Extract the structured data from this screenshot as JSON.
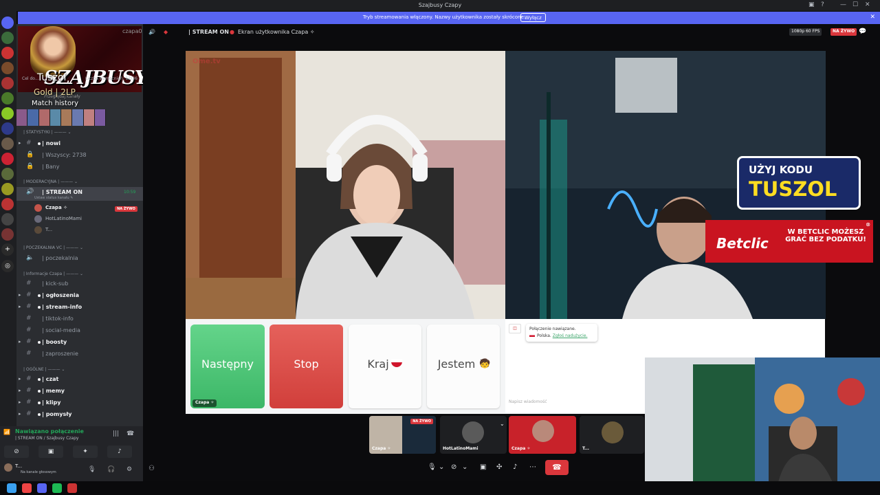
{
  "window": {
    "title": "Szajbusy Czapy"
  },
  "banner": {
    "text": "Tryb streamowania włączony. Nazwy użytkownika zostały skrócone.",
    "button": "Wyłącz"
  },
  "server": {
    "logo_text": "SZAJBUSY",
    "sub_label": "czapa0",
    "boost_left": "Cel do...",
    "boost_right": "Liczba wzmocnień: 12/36 ›",
    "browse": "Przeglądaj kanały"
  },
  "overlay": {
    "summoner": "Tuszol",
    "rank": "Gold | 2LP",
    "match_history": "Match history"
  },
  "categories": {
    "stats": "| STATYSTYKI | ——— ⌄",
    "moderation": "| MODERACYJNA | ——— ⌄",
    "waiting": "| POCZEKALNIA VC | ——— ⌄",
    "info": "| Informacje Czapa | ——— ⌄",
    "general": "| OGÓLNE | ——— ⌄"
  },
  "channels": {
    "nowi": "| nowi",
    "wszyscy": "| Wszyscy: 2738",
    "bany": "| Bany",
    "stream_on": "| STREAM ON",
    "stream_on_time": "10:59",
    "stream_on_status": "Ustaw status kanału ✎",
    "poczekalnia": "| poczekalnia",
    "kick_sub": "| kick-sub",
    "ogloszenia": "| ogłoszenia",
    "stream_info": "| stream-info",
    "tiktok_info": "| tiktok-info",
    "social_media": "| social-media",
    "boosty": "| boosty",
    "zaproszenie": "| zaproszenie",
    "czat": "| czat",
    "memy": "| memy",
    "klipy": "| klipy",
    "pomysly": "| pomysły"
  },
  "voice_users": {
    "u1": "Czapa ✧",
    "u1_badge": "NA ŻYWO",
    "u2": "HotLatinoMami",
    "u3": "T..."
  },
  "voice_panel": {
    "status": "Nawiązano połączenie",
    "channel": "| STREAM ON / Szajbusy Czapy",
    "me": "T...",
    "me_status": "Na kanale głosowym"
  },
  "stage_header": {
    "channel": "| STREAM ON",
    "screen": "Ekran użytkownika Czapa ✧",
    "quality": "1080p 60 FPS",
    "live": "NA ŻYWO"
  },
  "ometv": {
    "logo": "Ome.tv",
    "btn_next": "Następny",
    "btn_stop": "Stop",
    "btn_country": "Kraj",
    "btn_gender": "Jestem",
    "name_tag": "Czapa ✧",
    "chat_connected": "Połączenie nawiązane.",
    "chat_country": "Polska.",
    "chat_report": "Zgłoś nadużycie.",
    "chat_placeholder": "Napisz wiadomość"
  },
  "ads": {
    "code_line1": "UŻYJ KODU",
    "code_line2": "TUSZOL",
    "brand": "Betclic",
    "promo": "W BETCLIC MOŻESZ GRAĆ BEZ PODATKU!"
  },
  "participants": {
    "p1": "Czapa ✧",
    "p1_badge": "NA ŻYWO",
    "p2": "HotLatinoMami",
    "p3": "Czapa ✧",
    "p4": "T..."
  },
  "colors": {
    "discord_bg": "#2b2d31",
    "blurple": "#5865f2",
    "live_red": "#da373c",
    "next_green": "#3cb767",
    "stop_red": "#d13f3b"
  }
}
